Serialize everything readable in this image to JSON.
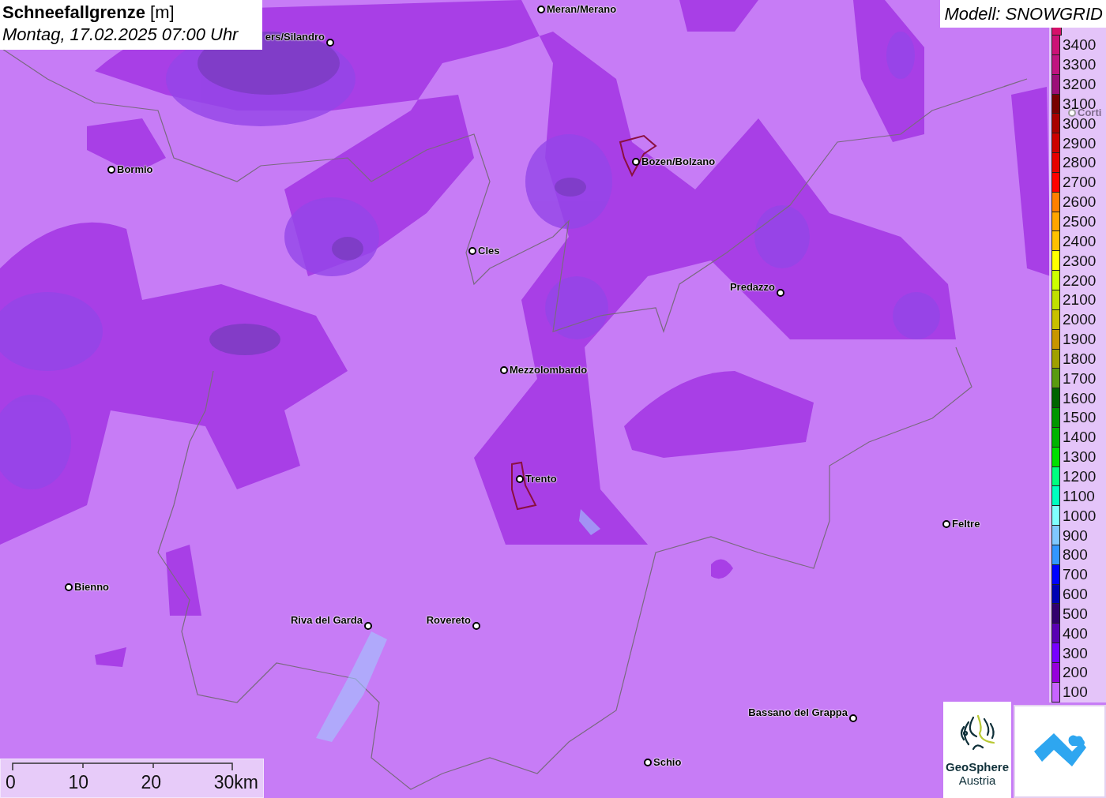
{
  "title": {
    "heading": "**Schneefallgrenze** [m]",
    "time": "Montag, 17.02.2025 07:00 Uhr"
  },
  "model": "Modell: SNOWGRID",
  "legend": [
    {
      "label": "3400",
      "color": "#cc1177"
    },
    {
      "label": "3300",
      "color": "#c01480"
    },
    {
      "label": "3200",
      "color": "#9c0e78"
    },
    {
      "label": "3100",
      "color": "#780000"
    },
    {
      "label": "3000",
      "color": "#a80000"
    },
    {
      "label": "2900",
      "color": "#cc0000"
    },
    {
      "label": "2800",
      "color": "#e60000"
    },
    {
      "label": "2700",
      "color": "#ff0000"
    },
    {
      "label": "2600",
      "color": "#ff8000"
    },
    {
      "label": "2500",
      "color": "#ffa500"
    },
    {
      "label": "2400",
      "color": "#ffc000"
    },
    {
      "label": "2300",
      "color": "#ffff00"
    },
    {
      "label": "2200",
      "color": "#ccff00"
    },
    {
      "label": "2100",
      "color": "#c0e000"
    },
    {
      "label": "2000",
      "color": "#c8c000"
    },
    {
      "label": "1900",
      "color": "#c89600"
    },
    {
      "label": "1800",
      "color": "#a0a000"
    },
    {
      "label": "1700",
      "color": "#5a9a10"
    },
    {
      "label": "1600",
      "color": "#006400"
    },
    {
      "label": "1500",
      "color": "#009600"
    },
    {
      "label": "1400",
      "color": "#00b400"
    },
    {
      "label": "1300",
      "color": "#00e000"
    },
    {
      "label": "1200",
      "color": "#00ff80"
    },
    {
      "label": "1100",
      "color": "#00ffc0"
    },
    {
      "label": "1000",
      "color": "#80ffff"
    },
    {
      "label": "900",
      "color": "#80c8ff"
    },
    {
      "label": "800",
      "color": "#3296ff"
    },
    {
      "label": "700",
      "color": "#0000ff"
    },
    {
      "label": "600",
      "color": "#0000b4"
    },
    {
      "label": "500",
      "color": "#32006e"
    },
    {
      "label": "400",
      "color": "#5a00b4"
    },
    {
      "label": "300",
      "color": "#7800ff"
    },
    {
      "label": "200",
      "color": "#9600dc"
    },
    {
      "label": "100",
      "color": "#c864ff"
    }
  ],
  "places": [
    {
      "name": "ers/Silandro",
      "label_left": true,
      "faded": false
    },
    {
      "name": "Meran/Merano",
      "label_left": false,
      "faded": false
    },
    {
      "name": "Bormio",
      "label_left": false,
      "faded": false
    },
    {
      "name": "Bozen/Bolzano",
      "label_left": false,
      "faded": false
    },
    {
      "name": "Cles",
      "label_left": false,
      "faded": false
    },
    {
      "name": "Predazzo",
      "label_left": true,
      "faded": false
    },
    {
      "name": "Mezzolombardo",
      "label_left": false,
      "faded": false
    },
    {
      "name": "Trento",
      "label_left": false,
      "faded": false
    },
    {
      "name": "Feltre",
      "label_left": false,
      "faded": false
    },
    {
      "name": "Bienno",
      "label_left": false,
      "faded": false
    },
    {
      "name": "Riva del Garda",
      "label_left": true,
      "faded": false
    },
    {
      "name": "Rovereto",
      "label_left": true,
      "faded": false
    },
    {
      "name": "Bassano del Grappa",
      "label_left": true,
      "faded": false
    },
    {
      "name": "Schio",
      "label_left": false,
      "faded": false
    },
    {
      "name": "Corti",
      "label_left": false,
      "faded": true
    }
  ],
  "scale_bar": {
    "labels": [
      "0",
      "10",
      "20",
      "30km"
    ]
  },
  "logo": {
    "name": "GeoSphere",
    "subtitle": "Austria"
  }
}
